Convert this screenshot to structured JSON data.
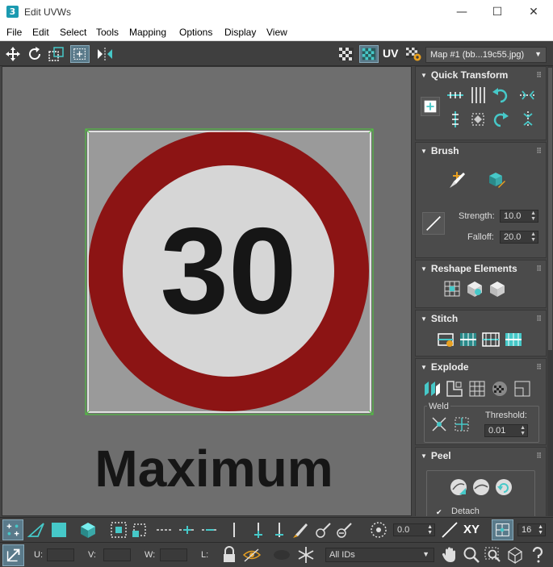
{
  "window": {
    "title": "Edit UVWs",
    "app_badge": "3",
    "minimize": "—",
    "maximize": "☐",
    "close": "✕"
  },
  "menu": [
    "File",
    "Edit",
    "Select",
    "Tools",
    "Mapping",
    "Options",
    "Display",
    "View"
  ],
  "toolbar": {
    "uv_label": "UV",
    "map_select": "Map #1 (bb...19c55.jpg)"
  },
  "viewport": {
    "sign_number": "30",
    "sign_text": "Maximum",
    "colors": {
      "ring": "#8c1414",
      "sign_fill": "#d6d6d6",
      "text": "#161616",
      "uv_edge": "#ffffff",
      "uv_border": "#4ccb3a",
      "background": "#6e6e6e"
    }
  },
  "panel": {
    "quick_transform": {
      "title": "Quick Transform"
    },
    "brush": {
      "title": "Brush",
      "strength_label": "Strength:",
      "strength": "10.0",
      "falloff_label": "Falloff:",
      "falloff": "20.0"
    },
    "reshape": {
      "title": "Reshape Elements"
    },
    "stitch": {
      "title": "Stitch"
    },
    "explode": {
      "title": "Explode",
      "weld_label": "Weld",
      "threshold_label": "Threshold:",
      "threshold": "0.01"
    },
    "peel": {
      "title": "Peel",
      "detach_label": "Detach",
      "detach_checked": true
    }
  },
  "bottom": {
    "rotation_value": "0.0",
    "xy_label": "XY",
    "grid_value": "16",
    "u_label": "U:",
    "v_label": "V:",
    "w_label": "W:",
    "l_label": "L:",
    "ids_select": "All IDs"
  },
  "accent_color": "#46c8c8"
}
